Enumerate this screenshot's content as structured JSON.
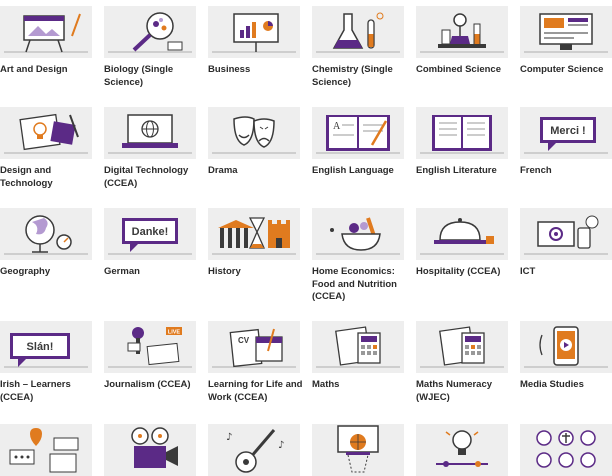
{
  "colors": {
    "tile_bg": "#eeeeee",
    "purple": "#5b2a86",
    "orange": "#e07b1f",
    "ink": "#3a3a3a"
  },
  "subjects": [
    {
      "label": "Art and Design",
      "icon": "easel-icon"
    },
    {
      "label": "Biology (Single Science)",
      "icon": "magnifier-icon"
    },
    {
      "label": "Business",
      "icon": "presentation-board-icon"
    },
    {
      "label": "Chemistry (Single Science)",
      "icon": "flask-icon"
    },
    {
      "label": "Combined Science",
      "icon": "science-bench-icon"
    },
    {
      "label": "Computer Science",
      "icon": "computer-icon"
    },
    {
      "label": "Design and Technology",
      "icon": "lightbulb-sketch-icon"
    },
    {
      "label": "Digital Technology (CCEA)",
      "icon": "laptop-globe-icon"
    },
    {
      "label": "Drama",
      "icon": "theatre-masks-icon"
    },
    {
      "label": "English Language",
      "icon": "open-book-pen-icon"
    },
    {
      "label": "English Literature",
      "icon": "open-book-icon"
    },
    {
      "label": "French",
      "icon": "speech-sign-icon",
      "word": "Merci !"
    },
    {
      "label": "Geography",
      "icon": "globe-compass-icon"
    },
    {
      "label": "German",
      "icon": "speech-sign-icon",
      "word": "Danke!"
    },
    {
      "label": "History",
      "icon": "hourglass-castle-icon"
    },
    {
      "label": "Home Economics: Food and Nutrition (CCEA)",
      "icon": "food-bowl-icon"
    },
    {
      "label": "Hospitality (CCEA)",
      "icon": "cloche-icon"
    },
    {
      "label": "ICT",
      "icon": "devices-icon"
    },
    {
      "label": "Irish – Learners (CCEA)",
      "icon": "speech-sign-icon",
      "word": "Slán!"
    },
    {
      "label": "Journalism (CCEA)",
      "icon": "microphone-news-icon",
      "badge": "LIVE"
    },
    {
      "label": "Learning for Life and Work (CCEA)",
      "icon": "cv-documents-icon",
      "badge": "CV"
    },
    {
      "label": "Maths",
      "icon": "calculator-papers-icon"
    },
    {
      "label": "Maths Numeracy (WJEC)",
      "icon": "calculator-papers-icon"
    },
    {
      "label": "Media Studies",
      "icon": "phone-play-icon"
    },
    {
      "label": "",
      "icon": "map-chat-icon"
    },
    {
      "label": "",
      "icon": "film-projector-icon"
    },
    {
      "label": "",
      "icon": "guitar-icon"
    },
    {
      "label": "",
      "icon": "basketball-hoop-icon"
    },
    {
      "label": "",
      "icon": "lightbulb-circuit-icon"
    },
    {
      "label": "",
      "icon": "religion-symbols-icon"
    }
  ]
}
